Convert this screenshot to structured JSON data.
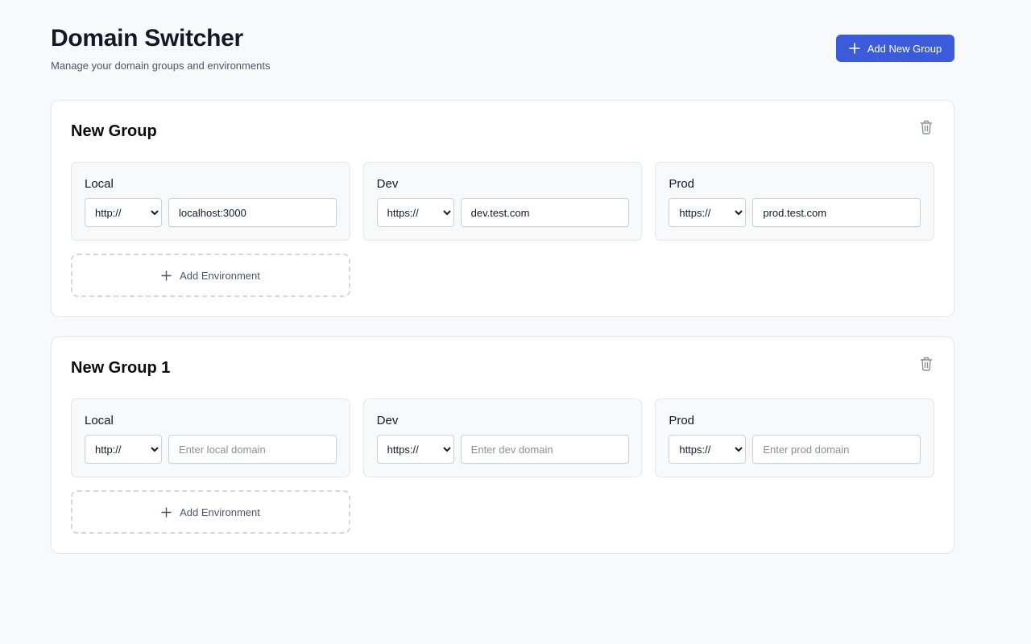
{
  "header": {
    "title": "Domain Switcher",
    "subtitle": "Manage your domain groups and environments",
    "add_group_label": "Add New Group"
  },
  "icons": {
    "plus": "plus-icon",
    "delete": "trash-icon"
  },
  "colors": {
    "primary": "#3b5bdb",
    "background": "#f8f9fb",
    "card_border": "#e5e7eb",
    "muted_text": "#4b5563"
  },
  "groups": [
    {
      "title": "New Group",
      "add_env_label": "Add Environment",
      "environments": [
        {
          "name": "Local",
          "protocol": "http://",
          "domain": "localhost:3000",
          "placeholder": ""
        },
        {
          "name": "Dev",
          "protocol": "https://",
          "domain": "dev.test.com",
          "placeholder": ""
        },
        {
          "name": "Prod",
          "protocol": "https://",
          "domain": "prod.test.com",
          "placeholder": ""
        }
      ]
    },
    {
      "title": "New Group 1",
      "add_env_label": "Add Environment",
      "environments": [
        {
          "name": "Local",
          "protocol": "http://",
          "domain": "",
          "placeholder": "Enter local domain"
        },
        {
          "name": "Dev",
          "protocol": "https://",
          "domain": "",
          "placeholder": "Enter dev domain"
        },
        {
          "name": "Prod",
          "protocol": "https://",
          "domain": "",
          "placeholder": "Enter prod domain"
        }
      ]
    }
  ]
}
